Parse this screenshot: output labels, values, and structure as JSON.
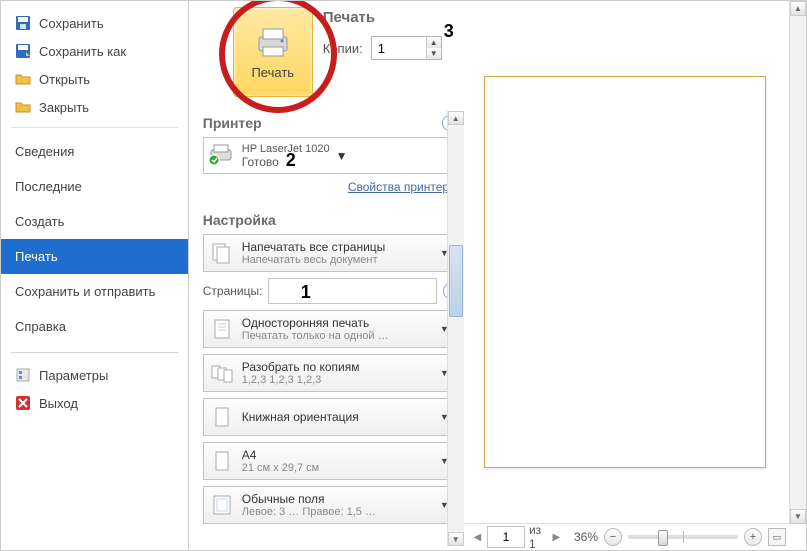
{
  "sidebar": {
    "save": "Сохранить",
    "save_as": "Сохранить как",
    "open": "Открыть",
    "close": "Закрыть",
    "info": "Сведения",
    "recent": "Последние",
    "new": "Создать",
    "print": "Печать",
    "save_send": "Сохранить и отправить",
    "help": "Справка",
    "options": "Параметры",
    "exit": "Выход"
  },
  "print": {
    "button": "Печать",
    "header": "Печать",
    "copies_label": "Копии:",
    "copies_value": "1"
  },
  "annotations": {
    "a1": "1",
    "a2": "2",
    "a3": "3"
  },
  "printer": {
    "section": "Принтер",
    "name": "HP LaserJet 1020",
    "status": "Готово",
    "properties": "Свойства принтера"
  },
  "settings": {
    "section": "Настройка",
    "pages_label": "Страницы:",
    "items": [
      {
        "title": "Напечатать все страницы",
        "sub": "Напечатать весь документ"
      },
      {
        "title": "Односторонняя печать",
        "sub": "Печатать только на одной …"
      },
      {
        "title": "Разобрать по копиям",
        "sub": "1,2,3   1,2,3   1,2,3"
      },
      {
        "title": "Книжная ориентация",
        "sub": ""
      },
      {
        "title": "A4",
        "sub": "21 см x 29,7 см"
      },
      {
        "title": "Обычные поля",
        "sub": "Левое: 3 …   Правое: 1,5 …"
      }
    ]
  },
  "preview": {
    "page_current": "1",
    "page_of": "из 1",
    "zoom": "36%"
  }
}
